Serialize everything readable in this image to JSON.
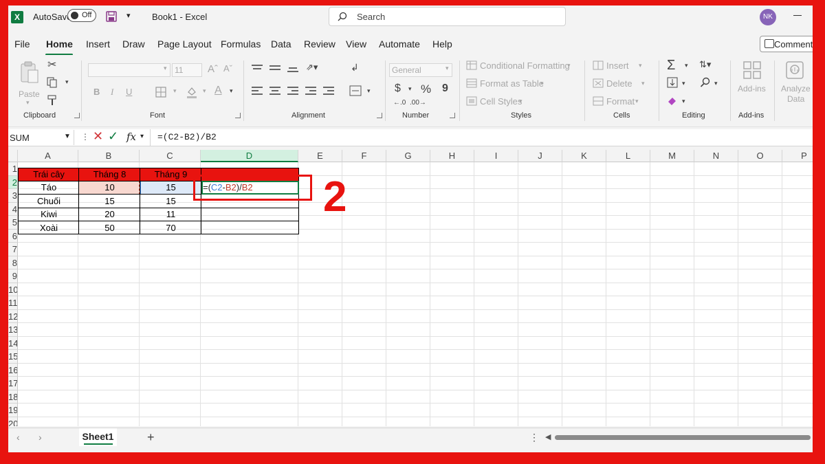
{
  "titlebar": {
    "autosave_label": "AutoSave",
    "autosave_state": "Off",
    "doc_title": "Book1  -  Excel",
    "search_placeholder": "Search",
    "avatar_initials": "NK"
  },
  "menu": {
    "tabs": [
      "File",
      "Home",
      "Insert",
      "Draw",
      "Page Layout",
      "Formulas",
      "Data",
      "Review",
      "View",
      "Automate",
      "Help"
    ],
    "active": "Home",
    "comments_label": "Comment"
  },
  "ribbon": {
    "clipboard": {
      "paste": "Paste",
      "label": "Clipboard"
    },
    "font": {
      "name": "",
      "size": "11",
      "bold": "B",
      "italic": "I",
      "underline": "U",
      "label": "Font"
    },
    "alignment": {
      "label": "Alignment"
    },
    "number": {
      "format": "General",
      "currency": "$",
      "percent": "%",
      "comma": "9",
      "label": "Number"
    },
    "styles": {
      "conditional": "Conditional Formatting",
      "format_table": "Format as Table",
      "cell_styles": "Cell Styles",
      "label": "Styles"
    },
    "cells": {
      "insert": "Insert",
      "delete": "Delete",
      "format": "Format",
      "label": "Cells"
    },
    "editing": {
      "label": "Editing"
    },
    "addins": {
      "addins": "Add-ins",
      "label": "Add-ins"
    },
    "analyze": {
      "line1": "Analyze",
      "line2": "Data"
    }
  },
  "formula_bar": {
    "name_box": "SUM",
    "fx": "fx",
    "formula": "=(C2-B2)/B2"
  },
  "grid": {
    "columns": [
      "A",
      "B",
      "C",
      "D",
      "E",
      "F",
      "G",
      "H",
      "I",
      "J",
      "K",
      "L",
      "M",
      "N",
      "O",
      "P"
    ],
    "rows": [
      "1",
      "2",
      "3",
      "4",
      "5",
      "6",
      "7",
      "8",
      "9",
      "10",
      "11",
      "12",
      "13",
      "14",
      "15",
      "16",
      "17",
      "18",
      "19",
      "20"
    ],
    "table": [
      [
        "Trái cây",
        "Tháng 8",
        "Tháng 9"
      ],
      [
        "Táo",
        "10",
        "15"
      ],
      [
        "Chuối",
        "15",
        "15"
      ],
      [
        "Kiwi",
        "20",
        "11"
      ],
      [
        "Xoài",
        "50",
        "70"
      ]
    ],
    "active_cell_formula": {
      "prefix": "=(",
      "c_ref": "C2",
      "minus": "-",
      "b_ref": "B2",
      "mid": ")/",
      "b_ref2": "B2"
    },
    "annotation": "2"
  },
  "sheets": {
    "tabs": [
      "Sheet1"
    ],
    "add": "+"
  },
  "colors": {
    "accent": "#107c41",
    "table_header": "#e8130f",
    "annotation": "#e8130f",
    "frame": "#e8130f"
  }
}
